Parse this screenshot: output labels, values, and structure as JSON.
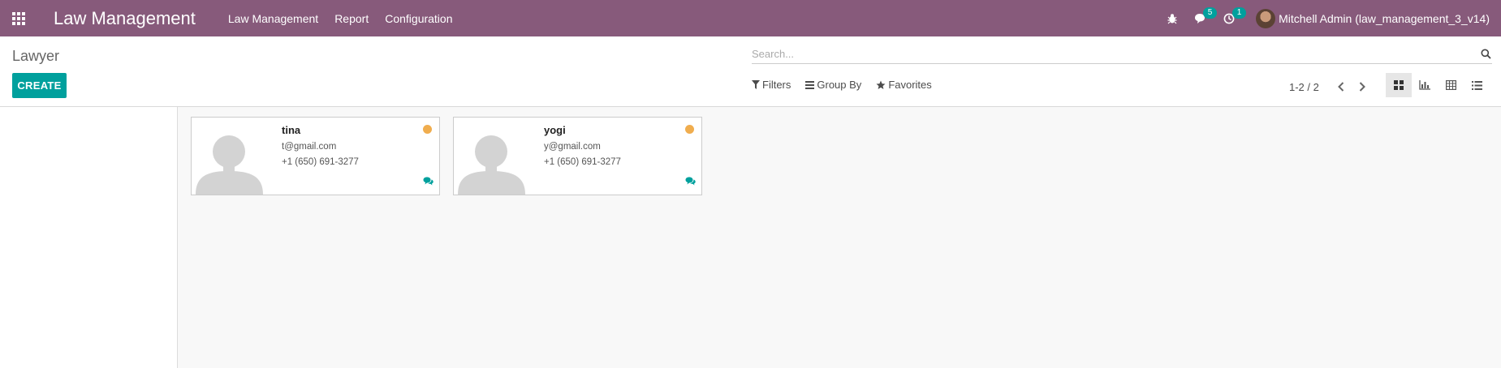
{
  "app": {
    "brand": "Law Management",
    "menu": [
      "Law Management",
      "Report",
      "Configuration"
    ]
  },
  "systray": {
    "messages_count": "5",
    "activities_count": "1",
    "user_name": "Mitchell Admin (law_management_3_v14)"
  },
  "control_panel": {
    "title": "Lawyer",
    "create_label": "CREATE",
    "search_placeholder": "Search...",
    "filters_label": "Filters",
    "group_by_label": "Group By",
    "favorites_label": "Favorites",
    "pager_value": "1-2 / 2",
    "views": [
      "kanban",
      "graph",
      "pivot",
      "list"
    ],
    "active_view": "kanban"
  },
  "lawyers": [
    {
      "name": "tina",
      "email": "t@gmail.com",
      "phone": "+1 (650) 691-3277",
      "status_color": "#f0ad4e"
    },
    {
      "name": "yogi",
      "email": "y@gmail.com",
      "phone": "+1 (650) 691-3277",
      "status_color": "#f0ad4e"
    }
  ],
  "colors": {
    "navbar": "#875a7b",
    "primary": "#00a09d"
  }
}
